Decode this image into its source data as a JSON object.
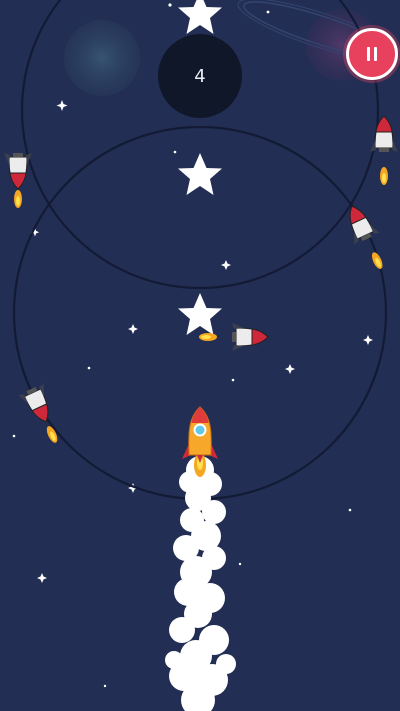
{
  "hud": {
    "score": "4"
  },
  "colors": {
    "background": "#222e54",
    "orbit_line": "#141c36",
    "star": "#ffffff",
    "pause_button": "#e8415e",
    "rocket_body": "#f2f2f2",
    "rocket_nose": "#d0283b",
    "player_rocket": "#f7a72a"
  },
  "icons": [
    "star-icon",
    "pause-icon",
    "rocket-icon",
    "planet-icon"
  ]
}
